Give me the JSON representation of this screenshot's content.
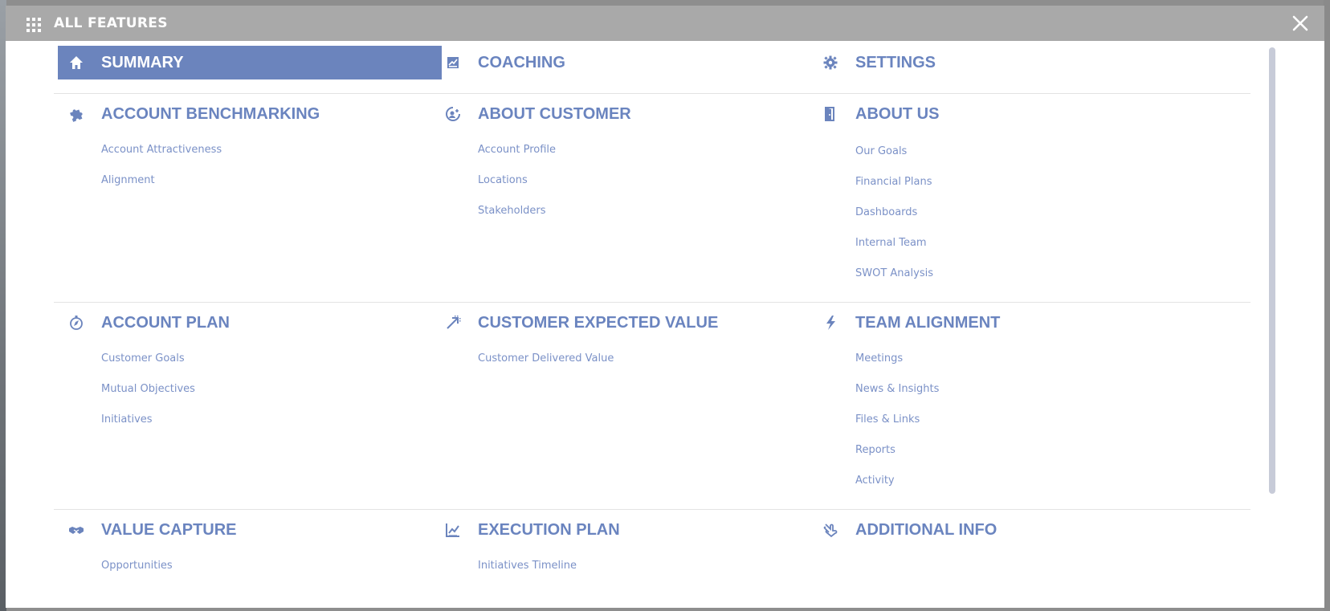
{
  "header": {
    "title": "ALL FEATURES"
  },
  "rows": [
    [
      {
        "title": "SUMMARY",
        "icon": "home-icon",
        "active": true,
        "links": []
      },
      {
        "title": "COACHING",
        "icon": "coaching-icon",
        "links": []
      },
      {
        "title": "SETTINGS",
        "icon": "gear-icon",
        "links": []
      }
    ],
    [
      {
        "title": "ACCOUNT BENCHMARKING",
        "icon": "puzzle-icon",
        "links": [
          "Account Attractiveness",
          "Alignment"
        ]
      },
      {
        "title": "ABOUT CUSTOMER",
        "icon": "customer-icon",
        "links": [
          "Account Profile",
          "Locations",
          "Stakeholders"
        ]
      },
      {
        "title": "ABOUT US",
        "icon": "door-icon",
        "links": [
          "Our Goals",
          "Financial Plans",
          "Dashboards",
          "Internal Team",
          "SWOT Analysis"
        ]
      }
    ],
    [
      {
        "title": "ACCOUNT PLAN",
        "icon": "compass-icon",
        "links": [
          "Customer Goals",
          "Mutual Objectives",
          "Initiatives"
        ]
      },
      {
        "title": "CUSTOMER EXPECTED VALUE",
        "icon": "arrow-up-right-icon",
        "links": [
          "Customer Delivered Value"
        ]
      },
      {
        "title": "TEAM ALIGNMENT",
        "icon": "lightning-icon",
        "links": [
          "Meetings",
          "News & Insights",
          "Files & Links",
          "Reports",
          "Activity"
        ]
      }
    ],
    [
      {
        "title": "VALUE CAPTURE",
        "icon": "handshake-icon",
        "links": [
          "Opportunities"
        ]
      },
      {
        "title": "EXECUTION PLAN",
        "icon": "chart-line-icon",
        "links": [
          "Initiatives Timeline"
        ]
      },
      {
        "title": "ADDITIONAL INFO",
        "icon": "hand-pointer-icon",
        "links": []
      }
    ]
  ],
  "colors": {
    "accent": "#6b84bd",
    "link": "#7b91c7",
    "header_bg": "#a9a9a9"
  }
}
